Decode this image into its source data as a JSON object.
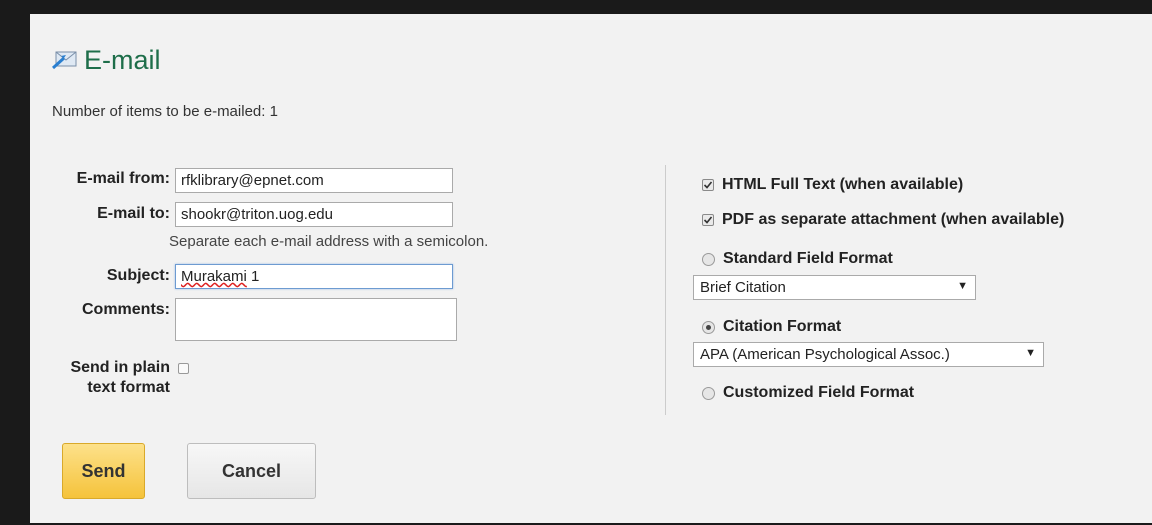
{
  "header": {
    "title": "E-mail",
    "items_count_text": "Number of items to be e-mailed: 1"
  },
  "form": {
    "from_label": "E-mail from:",
    "from_value": "rfklibrary@epnet.com",
    "to_label": "E-mail to:",
    "to_value": "shookr@triton.uog.edu",
    "to_hint": "Separate each e-mail address with a semicolon.",
    "subject_label": "Subject:",
    "subject_word": "Murakami",
    "subject_rest": " 1",
    "comments_label": "Comments:",
    "comments_value": "",
    "plain_text_label_line1": "Send in plain",
    "plain_text_label_line2": "text format",
    "plain_text_checked": false
  },
  "options": {
    "html_full_text": {
      "label": "HTML Full Text (when available)",
      "checked": true
    },
    "pdf_attachment": {
      "label": "PDF as separate attachment (when available)",
      "checked": true
    },
    "standard_field_format": {
      "label": "Standard Field Format",
      "selected": false
    },
    "standard_select_value": "Brief Citation",
    "citation_format": {
      "label": "Citation Format",
      "selected": true
    },
    "citation_select_value": "APA (American Psychological Assoc.)",
    "customized_field_format": {
      "label": "Customized Field Format",
      "selected": false
    }
  },
  "buttons": {
    "send_label": "Send",
    "cancel_label": "Cancel"
  },
  "colors": {
    "title": "#1e6e4a",
    "send_button": "#f5c33b",
    "background": "#f2f2f2"
  },
  "icons": [
    "email-icon",
    "checkbox-icon",
    "radio-icon",
    "dropdown-arrow-icon"
  ]
}
